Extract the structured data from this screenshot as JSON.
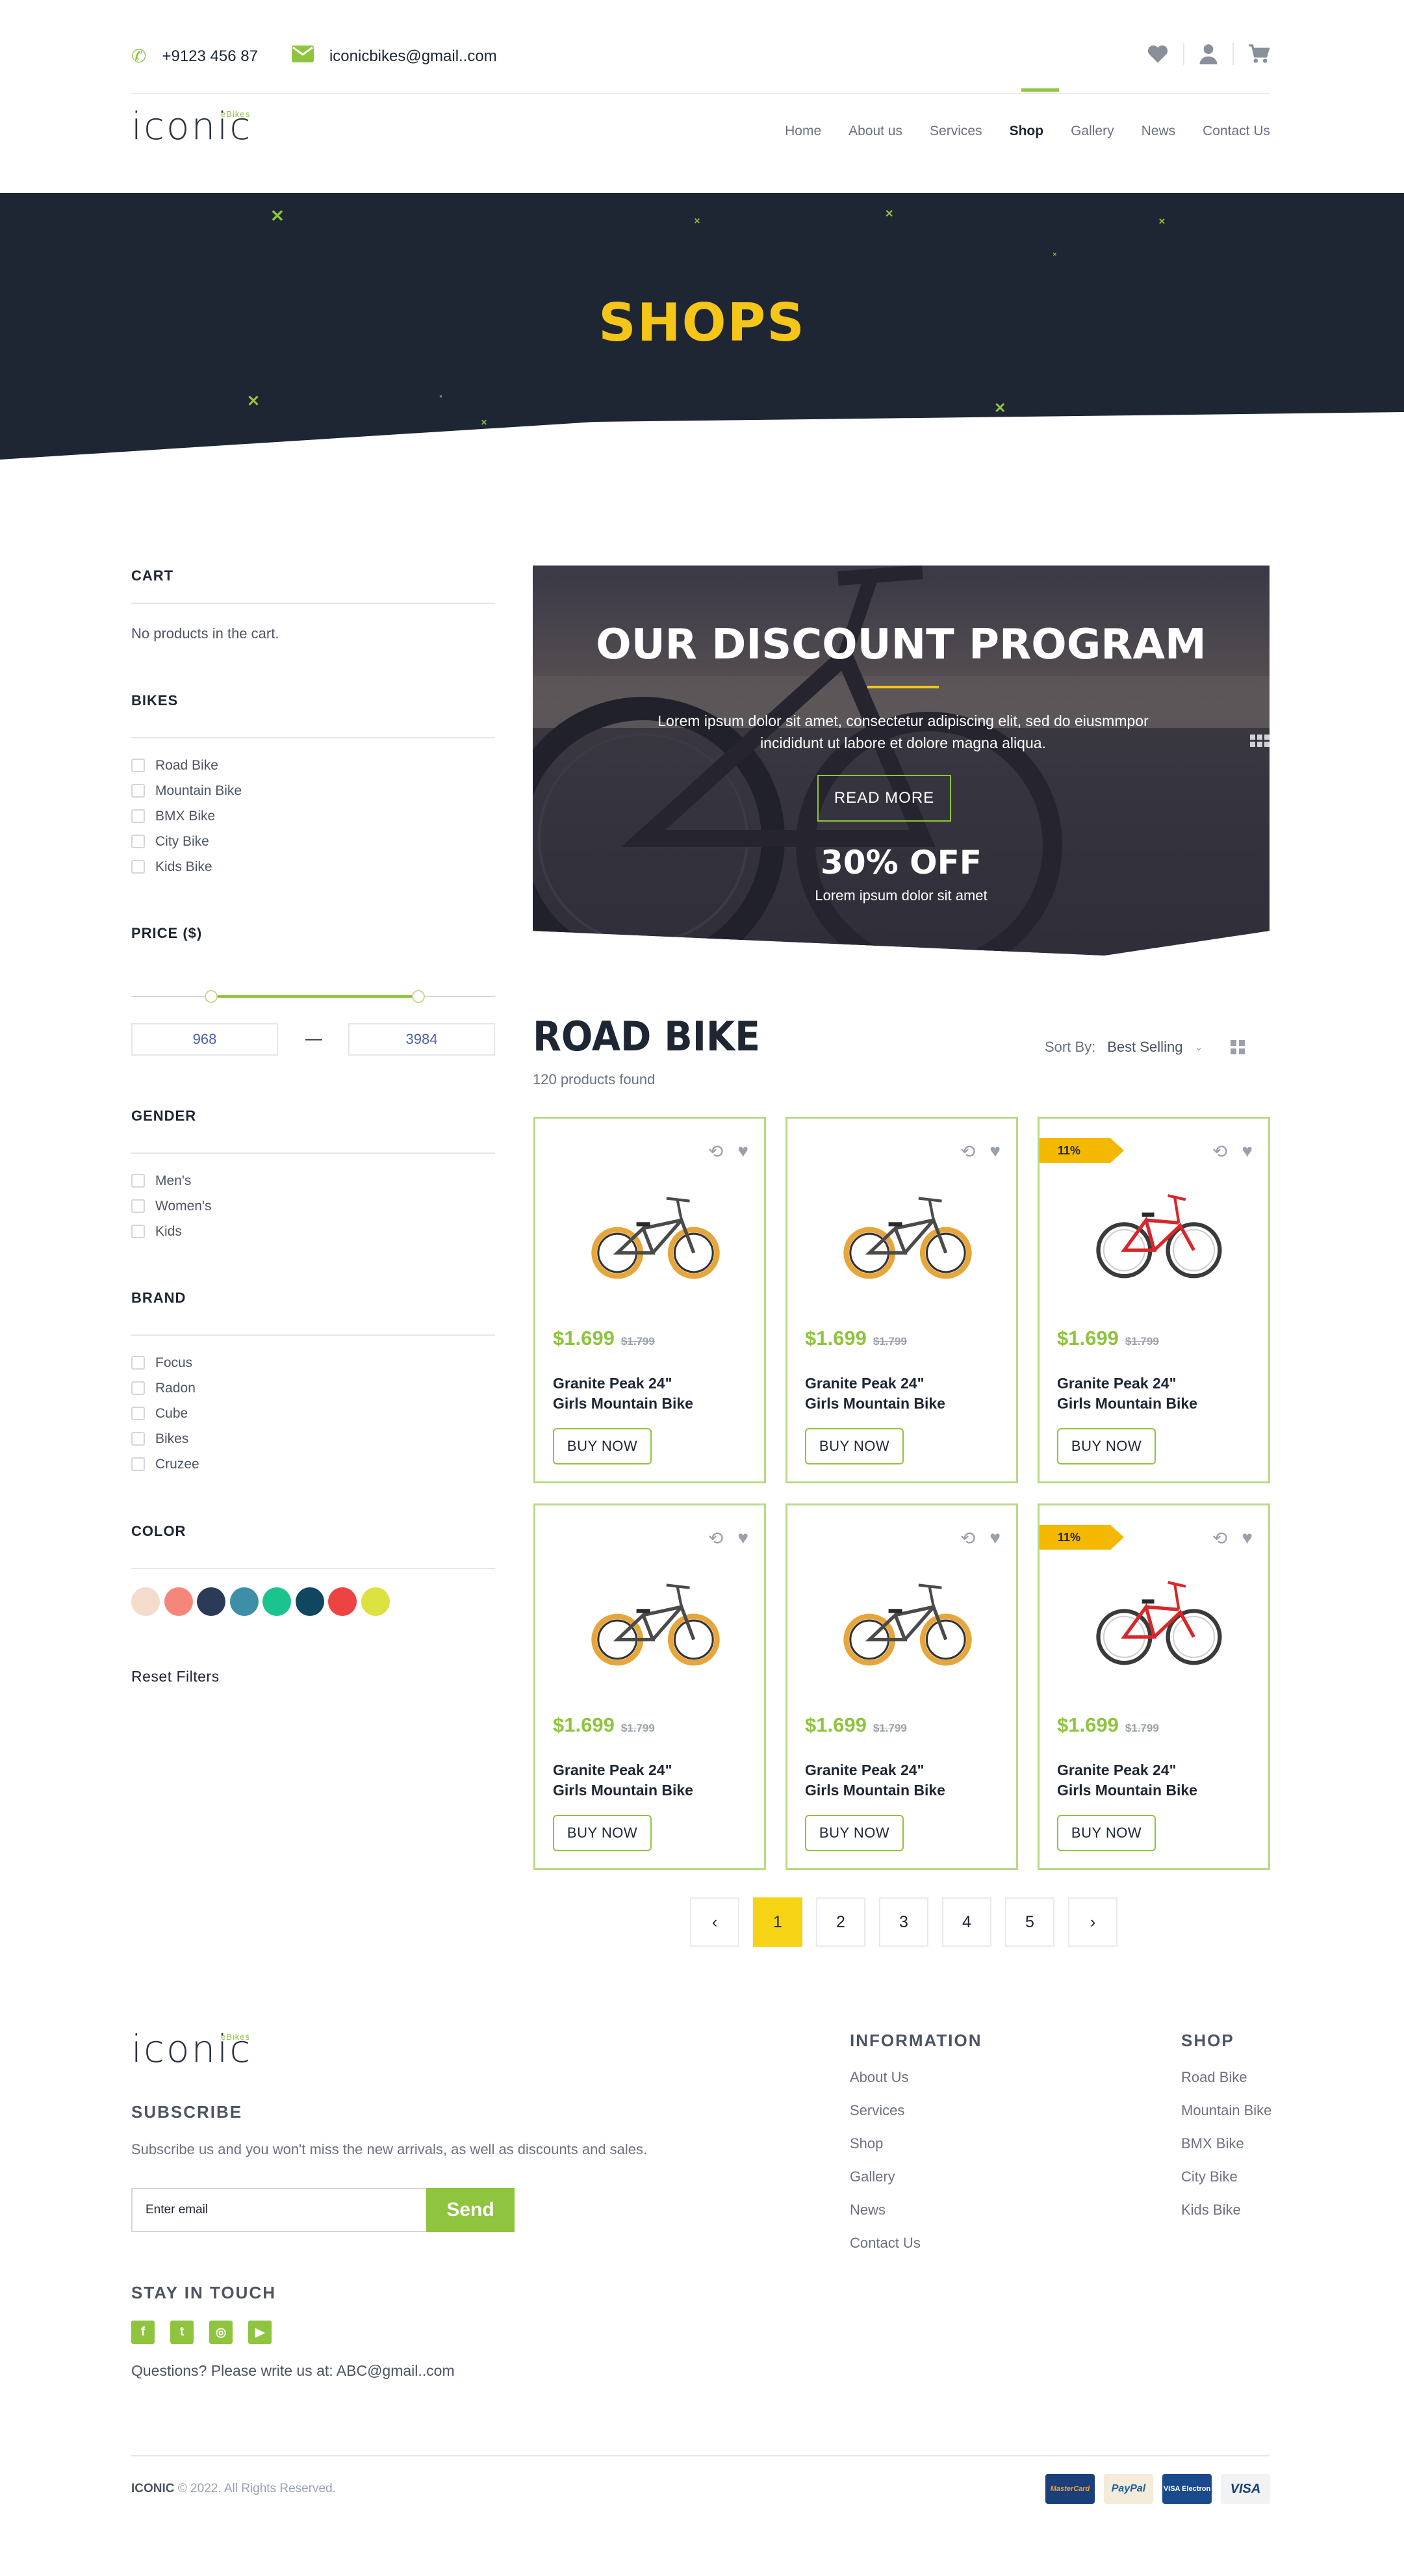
{
  "topbar": {
    "phone": "+9123 456 87",
    "email": "iconicbikes@gmail..com"
  },
  "logo": {
    "text": "ICONIC",
    "tag": "eBikes"
  },
  "nav": {
    "items": [
      "Home",
      "About us",
      "Services",
      "Shop",
      "Gallery",
      "News",
      "Contact Us"
    ],
    "active": "Shop"
  },
  "hero": {
    "title": "SHOPS"
  },
  "sidebar": {
    "cart": {
      "title": "CART",
      "empty_text": "No products in the cart."
    },
    "bikes": {
      "title": "BIKES",
      "options": [
        "Road Bike",
        "Mountain Bike",
        "BMX Bike",
        "City Bike",
        "Kids Bike"
      ]
    },
    "price": {
      "title": "PRICE ($)",
      "min": "968",
      "max": "3984",
      "dash": "—",
      "range_low_fraction": 0.22,
      "range_high_fraction": 0.79
    },
    "gender": {
      "title": "GENDER",
      "options": [
        "Men's",
        "Women's",
        "Kids"
      ]
    },
    "brand": {
      "title": "BRAND",
      "options": [
        "Focus",
        "Radon",
        "Cube",
        "Bikes",
        "Cruzee"
      ]
    },
    "color": {
      "title": "COLOR",
      "swatches": [
        "#f3dccb",
        "#f5877a",
        "#2b3a57",
        "#3e8ea8",
        "#1bc48e",
        "#0f4660",
        "#ee4343",
        "#dbe240"
      ]
    },
    "reset": "Reset Filters"
  },
  "banner": {
    "title": "OUR DISCOUNT PROGRAM",
    "text": "Lorem ipsum dolor sit amet, consectetur adipiscing elit, sed do eiusmmpor incididunt ut labore et dolore magna aliqua.",
    "button": "READ MORE",
    "offer": "30% OFF",
    "offer_sub": "Lorem ipsum dolor sit amet"
  },
  "products": {
    "title": "ROAD BIKE",
    "count": "120 products found",
    "sort_label": "Sort By:",
    "sort_value": "Best Selling",
    "items": [
      {
        "price": "$1.699",
        "old_price": "$1.799",
        "name_line1": "Granite Peak 24\"",
        "name_line2": "Girls Mountain Bike",
        "button": "BUY NOW",
        "badge": "",
        "bike": "bmx"
      },
      {
        "price": "$1.699",
        "old_price": "$1.799",
        "name_line1": "Granite Peak 24\"",
        "name_line2": "Girls Mountain Bike",
        "button": "BUY NOW",
        "badge": "",
        "bike": "bmx"
      },
      {
        "price": "$1.699",
        "old_price": "$1.799",
        "name_line1": "Granite Peak 24\"",
        "name_line2": "Girls Mountain Bike",
        "button": "BUY NOW",
        "badge": "11%",
        "bike": "red"
      },
      {
        "price": "$1.699",
        "old_price": "$1.799",
        "name_line1": "Granite Peak 24\"",
        "name_line2": "Girls Mountain Bike",
        "button": "BUY NOW",
        "badge": "",
        "bike": "bmx"
      },
      {
        "price": "$1.699",
        "old_price": "$1.799",
        "name_line1": "Granite Peak 24\"",
        "name_line2": "Girls Mountain Bike",
        "button": "BUY NOW",
        "badge": "",
        "bike": "bmx"
      },
      {
        "price": "$1.699",
        "old_price": "$1.799",
        "name_line1": "Granite Peak 24\"",
        "name_line2": "Girls Mountain Bike",
        "button": "BUY NOW",
        "badge": "11%",
        "bike": "red"
      }
    ]
  },
  "pagination": {
    "pages": [
      "1",
      "2",
      "3",
      "4",
      "5"
    ],
    "current": "1",
    "prev": "‹",
    "next": "›"
  },
  "footer": {
    "subscribe_title": "SUBSCRIBE",
    "subscribe_text": "Subscribe us and you won't miss the new arrivals, as well as discounts and sales.",
    "email_placeholder": "Enter email",
    "send": "Send",
    "stay_title": "STAY IN TOUCH",
    "question": "Questions? Please write us at: ABC@gmail..com",
    "information": {
      "title": "INFORMATION",
      "links": [
        "About Us",
        "Services",
        "Shop",
        "Gallery",
        "News",
        "Contact Us"
      ]
    },
    "shop": {
      "title": "SHOP",
      "links": [
        "Road Bike",
        "Mountain Bike",
        "BMX Bike",
        "City Bike",
        "Kids Bike"
      ]
    },
    "brand": "ICONIC",
    "copyright": "© 2022. All Rights Reserved.",
    "payments": [
      "MasterCard",
      "PayPal",
      "VISA Electron",
      "VISA"
    ]
  },
  "colors": {
    "accent": "#8fc43e",
    "yellow": "#f5c518",
    "dark": "#1e2533",
    "badge": "#f5b800"
  }
}
